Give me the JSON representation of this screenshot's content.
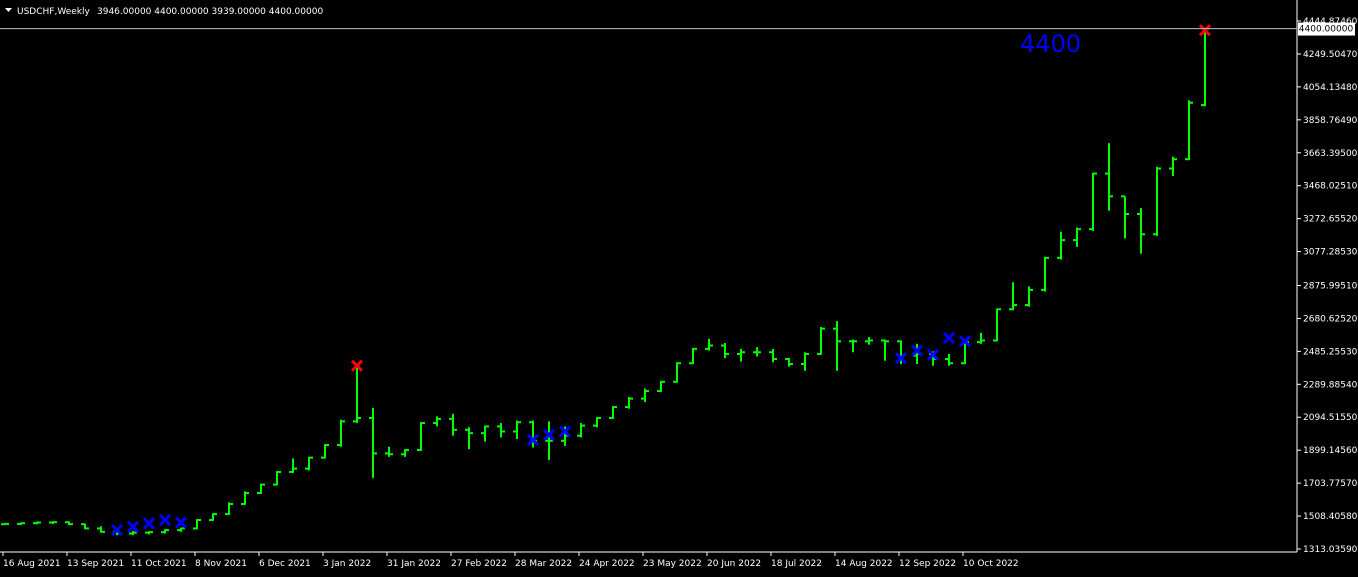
{
  "header": {
    "symbol": "USDCHF,Weekly",
    "ohlc": "3946.00000 4400.00000 3939.00000 4400.00000",
    "menu_icon": "triangle-down-icon"
  },
  "colors": {
    "background": "#000000",
    "bar": "#00ff00",
    "axis": "#ffffff",
    "marker_blue": "#0000ff",
    "marker_red": "#ff0000",
    "annotation": "#0000ff"
  },
  "annotation": {
    "text": "4400"
  },
  "chart_data": {
    "type": "ohlc",
    "title": "USDCHF,Weekly",
    "ylim": [
      1313.0359,
      4444.8746
    ],
    "y_ticks": [
      "4444.87460",
      "4249.50470",
      "4054.13480",
      "3858.76490",
      "3663.39500",
      "3468.02510",
      "3272.65520",
      "3077.28530",
      "2875.99510",
      "2680.62520",
      "2485.25530",
      "2289.88540",
      "2094.51550",
      "1899.14560",
      "1703.77570",
      "1508.40580",
      "1313.03590"
    ],
    "x_ticks": [
      "16 Aug 2021",
      "13 Sep 2021",
      "11 Oct 2021",
      "8 Nov 2021",
      "6 Dec 2021",
      "3 Jan 2022",
      "31 Jan 2022",
      "27 Feb 2022",
      "28 Mar 2022",
      "24 Apr 2022",
      "23 May 2022",
      "20 Jun 2022",
      "18 Jul 2022",
      "14 Aug 2022",
      "12 Sep 2022",
      "10 Oct 2022"
    ],
    "current_price": "4400.00000",
    "current_value": 4400,
    "bars": [
      {
        "o": 1460,
        "h": 1466,
        "l": 1455,
        "c": 1462
      },
      {
        "o": 1462,
        "h": 1470,
        "l": 1455,
        "c": 1466
      },
      {
        "o": 1466,
        "h": 1476,
        "l": 1460,
        "c": 1470
      },
      {
        "o": 1470,
        "h": 1478,
        "l": 1462,
        "c": 1472
      },
      {
        "o": 1472,
        "h": 1476,
        "l": 1455,
        "c": 1460
      },
      {
        "o": 1460,
        "h": 1462,
        "l": 1430,
        "c": 1435
      },
      {
        "o": 1435,
        "h": 1448,
        "l": 1410,
        "c": 1415
      },
      {
        "o": 1415,
        "h": 1425,
        "l": 1395,
        "c": 1405
      },
      {
        "o": 1405,
        "h": 1420,
        "l": 1395,
        "c": 1410
      },
      {
        "o": 1410,
        "h": 1418,
        "l": 1400,
        "c": 1413
      },
      {
        "o": 1413,
        "h": 1430,
        "l": 1405,
        "c": 1425
      },
      {
        "o": 1425,
        "h": 1440,
        "l": 1415,
        "c": 1435
      },
      {
        "o": 1435,
        "h": 1490,
        "l": 1430,
        "c": 1485
      },
      {
        "o": 1485,
        "h": 1525,
        "l": 1480,
        "c": 1520
      },
      {
        "o": 1520,
        "h": 1590,
        "l": 1515,
        "c": 1580
      },
      {
        "o": 1580,
        "h": 1655,
        "l": 1575,
        "c": 1645
      },
      {
        "o": 1645,
        "h": 1700,
        "l": 1640,
        "c": 1695
      },
      {
        "o": 1695,
        "h": 1775,
        "l": 1690,
        "c": 1770
      },
      {
        "o": 1770,
        "h": 1850,
        "l": 1765,
        "c": 1790
      },
      {
        "o": 1790,
        "h": 1860,
        "l": 1780,
        "c": 1855
      },
      {
        "o": 1855,
        "h": 1935,
        "l": 1850,
        "c": 1930
      },
      {
        "o": 1930,
        "h": 2080,
        "l": 1920,
        "c": 2070
      },
      {
        "o": 2070,
        "h": 2405,
        "l": 2060,
        "c": 2090
      },
      {
        "o": 2090,
        "h": 2150,
        "l": 1735,
        "c": 1880
      },
      {
        "o": 1880,
        "h": 1920,
        "l": 1860,
        "c": 1875
      },
      {
        "o": 1875,
        "h": 1905,
        "l": 1860,
        "c": 1900
      },
      {
        "o": 1900,
        "h": 2065,
        "l": 1895,
        "c": 2060
      },
      {
        "o": 2060,
        "h": 2100,
        "l": 2040,
        "c": 2085
      },
      {
        "o": 2085,
        "h": 2115,
        "l": 1985,
        "c": 2020
      },
      {
        "o": 2020,
        "h": 2035,
        "l": 1905,
        "c": 2000
      },
      {
        "o": 2000,
        "h": 2045,
        "l": 1950,
        "c": 2040
      },
      {
        "o": 2040,
        "h": 2060,
        "l": 1975,
        "c": 2010
      },
      {
        "o": 2010,
        "h": 2075,
        "l": 1965,
        "c": 2065
      },
      {
        "o": 2065,
        "h": 2075,
        "l": 1915,
        "c": 1955
      },
      {
        "o": 1955,
        "h": 2070,
        "l": 1840,
        "c": 1955
      },
      {
        "o": 1955,
        "h": 2040,
        "l": 1925,
        "c": 1985
      },
      {
        "o": 1985,
        "h": 2060,
        "l": 1975,
        "c": 2045
      },
      {
        "o": 2045,
        "h": 2095,
        "l": 2035,
        "c": 2090
      },
      {
        "o": 2090,
        "h": 2160,
        "l": 2085,
        "c": 2155
      },
      {
        "o": 2155,
        "h": 2215,
        "l": 2145,
        "c": 2205
      },
      {
        "o": 2205,
        "h": 2265,
        "l": 2185,
        "c": 2250
      },
      {
        "o": 2250,
        "h": 2310,
        "l": 2245,
        "c": 2305
      },
      {
        "o": 2305,
        "h": 2420,
        "l": 2300,
        "c": 2415
      },
      {
        "o": 2415,
        "h": 2505,
        "l": 2410,
        "c": 2500
      },
      {
        "o": 2500,
        "h": 2560,
        "l": 2490,
        "c": 2520
      },
      {
        "o": 2520,
        "h": 2535,
        "l": 2445,
        "c": 2470
      },
      {
        "o": 2470,
        "h": 2500,
        "l": 2425,
        "c": 2480
      },
      {
        "o": 2480,
        "h": 2510,
        "l": 2455,
        "c": 2480
      },
      {
        "o": 2480,
        "h": 2500,
        "l": 2420,
        "c": 2440
      },
      {
        "o": 2440,
        "h": 2445,
        "l": 2395,
        "c": 2410
      },
      {
        "o": 2410,
        "h": 2480,
        "l": 2370,
        "c": 2470
      },
      {
        "o": 2470,
        "h": 2630,
        "l": 2465,
        "c": 2620
      },
      {
        "o": 2620,
        "h": 2665,
        "l": 2370,
        "c": 2545
      },
      {
        "o": 2545,
        "h": 2555,
        "l": 2480,
        "c": 2545
      },
      {
        "o": 2545,
        "h": 2570,
        "l": 2525,
        "c": 2550
      },
      {
        "o": 2550,
        "h": 2555,
        "l": 2430,
        "c": 2545
      },
      {
        "o": 2545,
        "h": 2550,
        "l": 2410,
        "c": 2460
      },
      {
        "o": 2460,
        "h": 2530,
        "l": 2410,
        "c": 2470
      },
      {
        "o": 2470,
        "h": 2485,
        "l": 2400,
        "c": 2440
      },
      {
        "o": 2440,
        "h": 2470,
        "l": 2400,
        "c": 2415
      },
      {
        "o": 2415,
        "h": 2545,
        "l": 2410,
        "c": 2540
      },
      {
        "o": 2540,
        "h": 2595,
        "l": 2530,
        "c": 2550
      },
      {
        "o": 2550,
        "h": 2740,
        "l": 2545,
        "c": 2735
      },
      {
        "o": 2735,
        "h": 2895,
        "l": 2730,
        "c": 2760
      },
      {
        "o": 2760,
        "h": 2870,
        "l": 2750,
        "c": 2850
      },
      {
        "o": 2850,
        "h": 3045,
        "l": 2840,
        "c": 3040
      },
      {
        "o": 3040,
        "h": 3195,
        "l": 3030,
        "c": 3145
      },
      {
        "o": 3145,
        "h": 3220,
        "l": 3105,
        "c": 3210
      },
      {
        "o": 3210,
        "h": 3545,
        "l": 3200,
        "c": 3540
      },
      {
        "o": 3540,
        "h": 3720,
        "l": 3320,
        "c": 3405
      },
      {
        "o": 3405,
        "h": 3405,
        "l": 3155,
        "c": 3300
      },
      {
        "o": 3300,
        "h": 3335,
        "l": 3065,
        "c": 3180
      },
      {
        "o": 3180,
        "h": 3580,
        "l": 3170,
        "c": 3570
      },
      {
        "o": 3570,
        "h": 3640,
        "l": 3525,
        "c": 3625
      },
      {
        "o": 3625,
        "h": 3975,
        "l": 3620,
        "c": 3960
      },
      {
        "o": 3946,
        "h": 4400,
        "l": 3939,
        "c": 4400
      }
    ],
    "blue_markers": [
      {
        "bar": 7,
        "value": 1425
      },
      {
        "bar": 8,
        "value": 1445
      },
      {
        "bar": 9,
        "value": 1465
      },
      {
        "bar": 10,
        "value": 1485
      },
      {
        "bar": 11,
        "value": 1470
      },
      {
        "bar": 33,
        "value": 1960
      },
      {
        "bar": 34,
        "value": 1990
      },
      {
        "bar": 35,
        "value": 2010
      },
      {
        "bar": 56,
        "value": 2445
      },
      {
        "bar": 57,
        "value": 2490
      },
      {
        "bar": 58,
        "value": 2465
      },
      {
        "bar": 59,
        "value": 2565
      },
      {
        "bar": 60,
        "value": 2545
      }
    ],
    "red_markers": [
      {
        "bar": 22,
        "value": 2400
      },
      {
        "bar": 75,
        "value": 4390
      }
    ]
  }
}
